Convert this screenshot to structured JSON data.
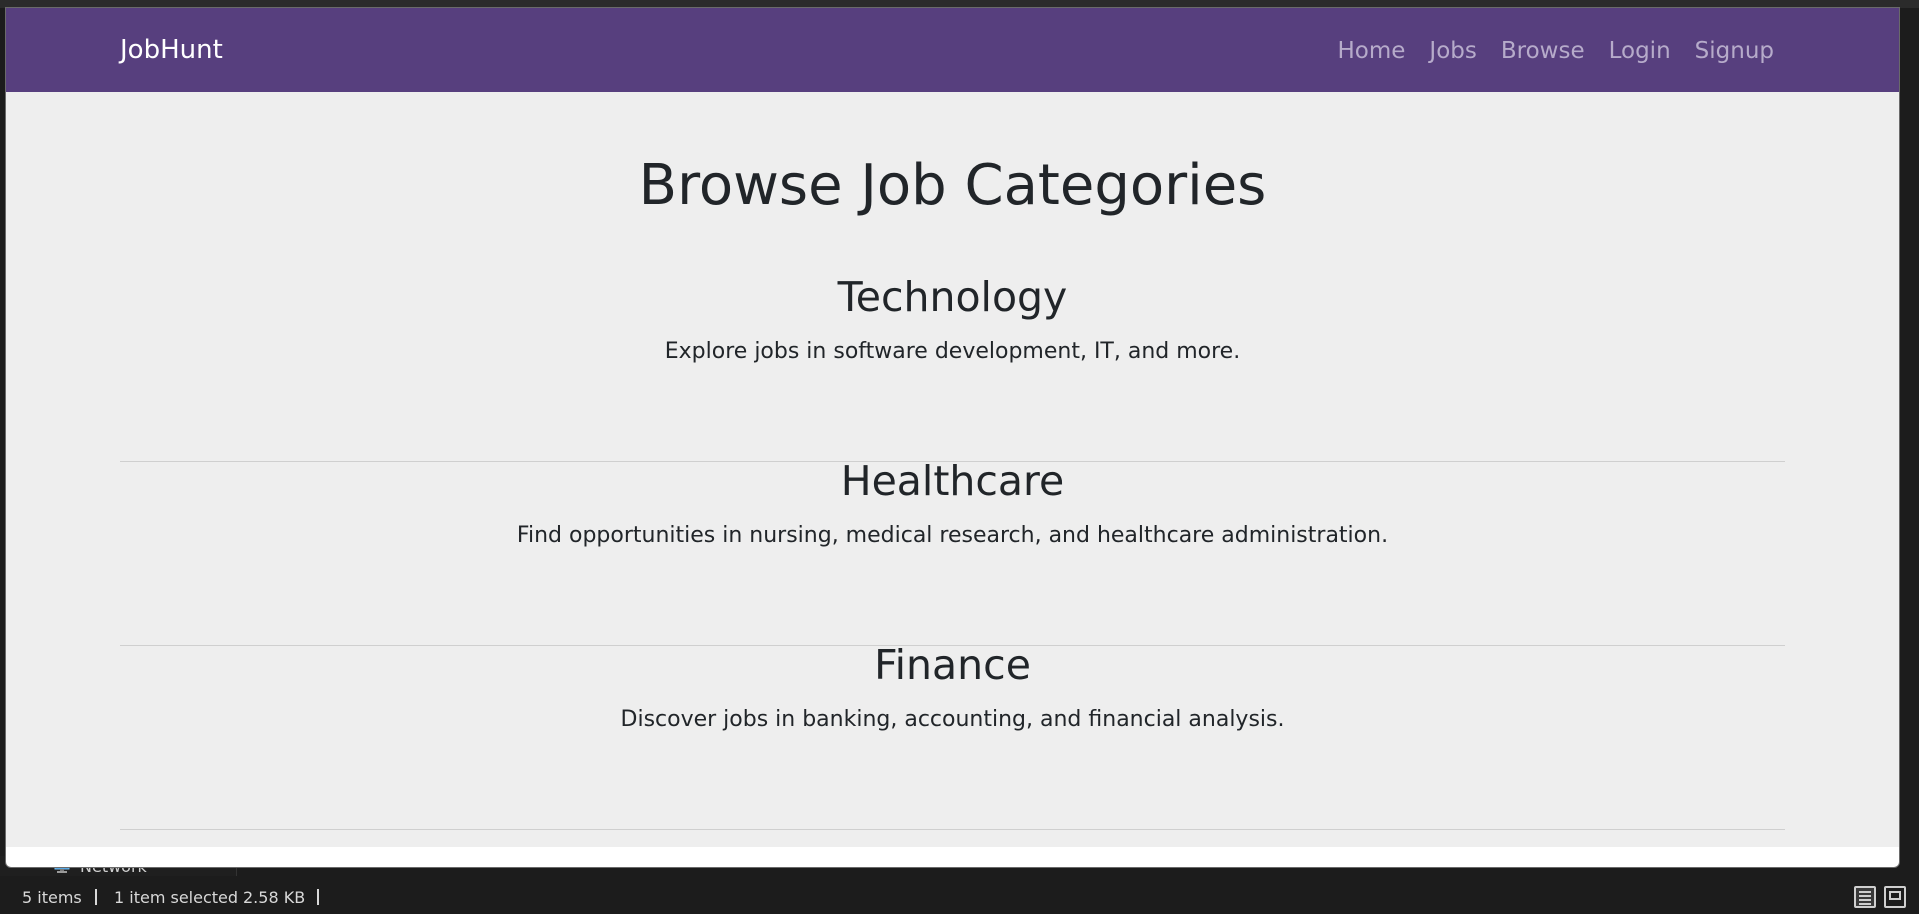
{
  "navbar": {
    "brand": "JobHunt",
    "links": [
      "Home",
      "Jobs",
      "Browse",
      "Login",
      "Signup"
    ]
  },
  "main": {
    "title": "Browse Job Categories",
    "categories": [
      {
        "name": "Technology",
        "description": "Explore jobs in software development, IT, and more."
      },
      {
        "name": "Healthcare",
        "description": "Find opportunities in nursing, medical research, and healthcare administration."
      },
      {
        "name": "Finance",
        "description": "Discover jobs in banking, accounting, and financial analysis."
      }
    ]
  },
  "explorer": {
    "nav_item": "Network",
    "status": {
      "item_count": "5 items",
      "selection": "1 item selected",
      "size": "2.58 KB"
    }
  },
  "colors": {
    "navbar_bg": "#573f7e",
    "content_bg": "#eeeeee",
    "text": "#212529",
    "nav_link": "#b6abca"
  },
  "icons": [
    "chevron-right-icon",
    "network-icon",
    "details-view-icon",
    "tiles-view-icon"
  ]
}
